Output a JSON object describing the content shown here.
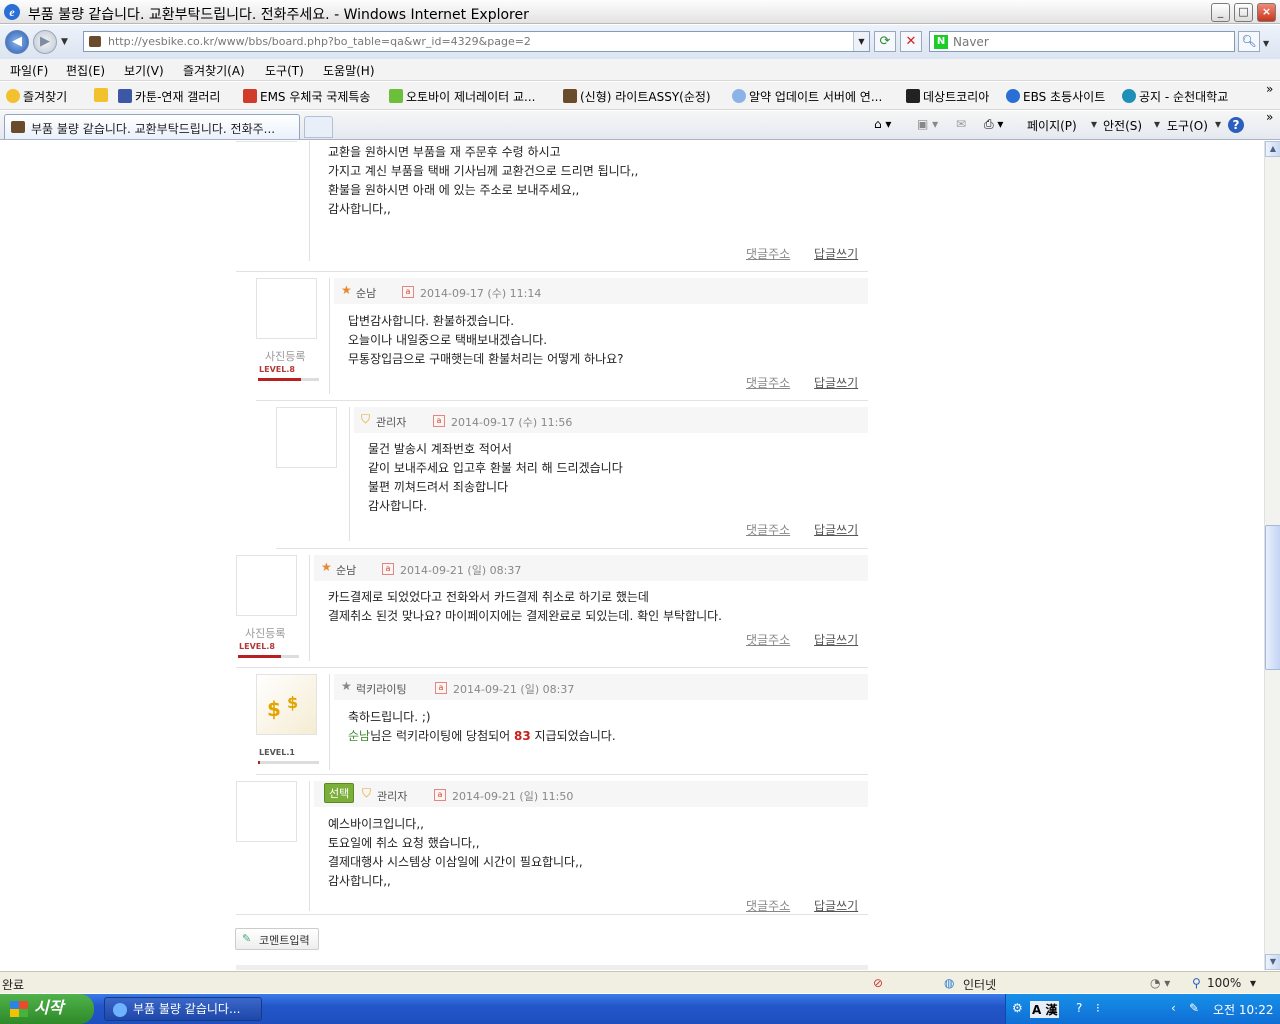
{
  "window": {
    "title": "부품 불량 같습니다. 교환부탁드립니다. 전화주세요. - Windows Internet Explorer",
    "minimize": "_",
    "maximize": "□",
    "close": "×"
  },
  "addressbar": {
    "url": "http://yesbike.co.kr/www/bbs/board.php?bo_table=qa&wr_id=4329&page=2",
    "search_placeholder": "Naver",
    "search_logo": "N"
  },
  "menu": [
    "파일(F)",
    "편집(E)",
    "보기(V)",
    "즐겨찾기(A)",
    "도구(T)",
    "도움말(H)"
  ],
  "favorites": {
    "label": "즐겨찾기",
    "items": [
      "카툰-연재 갤러리",
      "EMS 우체국 국제특송",
      "오토바이 제너레이터 교...",
      "(신형) 라이트ASSY(순정)",
      "알약 업데이트 서버에 연...",
      "데상트코리아",
      "EBS 초등사이트",
      "공지 - 순천대학교"
    ]
  },
  "tab": {
    "title": "부품 불량 같습니다. 교환부탁드립니다. 전화주..."
  },
  "commandbar": {
    "page": "페이지(P)",
    "safety": "안전(S)",
    "tools": "도구(O)",
    "help": "?"
  },
  "comments": [
    {
      "lines": [
        "교환을 원하시면 부품을 재 주문후 수령 하시고",
        "가지고 계신 부품을 택배 기사님께 교환건으로 드리면 됩니다,,",
        "환불을 원하시면 아래 에 있는 주소로 보내주세요,,",
        "감사합니다,,"
      ],
      "reply_link": "댓글주소",
      "write_link": "답글쓰기"
    },
    {
      "author": "순남",
      "date": "2014-09-17 (수) 11:14",
      "photo": "사진등록",
      "level": "LEVEL.8",
      "level_fill": 0.7,
      "lines": [
        "답변감사합니다. 환불하겠습니다.",
        "오늘이나 내일중으로 택배보내겠습니다.",
        "무통장입금으로 구매햇는데 환불처리는 어떻게 하나요?"
      ],
      "reply_link": "댓글주소",
      "write_link": "답글쓰기"
    },
    {
      "author": "관리자",
      "date": "2014-09-17 (수) 11:56",
      "lines": [
        "물건 발송시 계좌번호 적어서",
        "같이 보내주세요 입고후 환불 처리 해 드리겠습니다",
        "불편 끼쳐드려서 죄송합니다",
        "감사합니다."
      ],
      "reply_link": "댓글주소",
      "write_link": "답글쓰기"
    },
    {
      "author": "순남",
      "date": "2014-09-21 (일) 08:37",
      "photo": "사진등록",
      "level": "LEVEL.8",
      "level_fill": 0.7,
      "lines": [
        "카드결제로 되었었다고 전화와서 카드결제 취소로 하기로 했는데",
        "결제취소 된것 맞나요? 마이페이지에는 결제완료로 되있는데. 확인 부탁합니다."
      ],
      "reply_link": "댓글주소",
      "write_link": "답글쓰기"
    },
    {
      "author": "럭키라이팅",
      "date": "2014-09-21 (일) 08:37",
      "level": "LEVEL.1",
      "level_fill": 0.05,
      "line1": "축하드립니다. ;)",
      "winner": "순남",
      "mid": "님은 럭키라이팅에 당첨되어 ",
      "points": "83",
      "tail": " 지급되었습니다."
    },
    {
      "badge": "선택",
      "author": "관리자",
      "date": "2014-09-21 (일) 11:50",
      "lines": [
        "예스바이크입니다,,",
        "토요일에 취소 요청 했습니다,,",
        "결제대행사 시스템상 이삼일에 시간이 필요합니다,,",
        "감사합니다,,"
      ],
      "reply_link": "댓글주소",
      "write_link": "답글쓰기"
    }
  ],
  "comment_input_button": "코멘트입력",
  "status": {
    "text": "완료",
    "zone": "인터넷",
    "zoom": "100%"
  },
  "taskbar": {
    "start": "시작",
    "task": "부품 불량 같습니다...",
    "clock": "오전 10:22",
    "ime": "A 漢"
  }
}
